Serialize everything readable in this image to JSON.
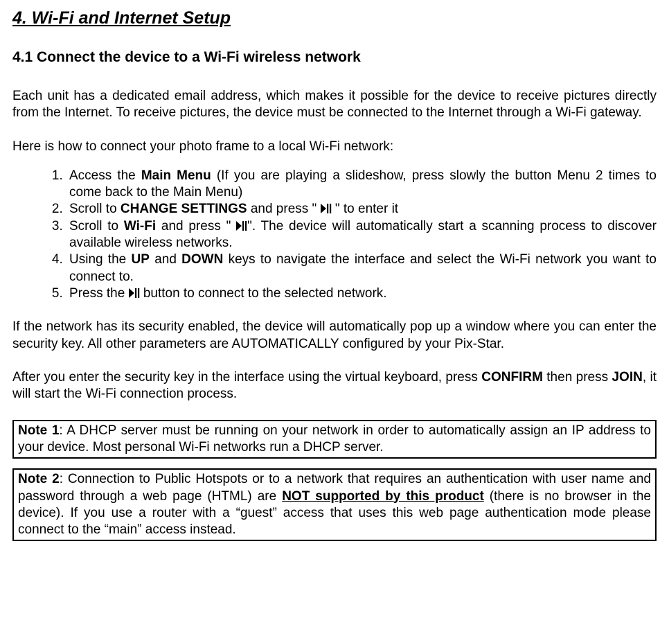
{
  "title": "4. Wi-Fi and Internet Setup",
  "subtitle": "4.1 Connect the device to a Wi-Fi wireless network",
  "intro1": "Each unit has a dedicated email address, which makes it possible for the device to receive pictures directly from the Internet. To receive pictures, the device must be connected to the Internet through a Wi-Fi gateway.",
  "intro2": "Here is how to connect your photo frame to a local Wi-Fi network:",
  "steps": {
    "s1a": "Access the ",
    "s1b": "Main Menu",
    "s1c": " (If you are playing a slideshow, press slowly the button Menu 2 times to come back to the Main Menu)",
    "s2a": "Scroll to ",
    "s2b": "CHANGE SETTINGS",
    "s2c": " and press \" ",
    "s2d": " \" to enter it",
    "s3a": "Scroll to ",
    "s3b": "Wi-Fi",
    "s3c": " and press \" ",
    "s3d": "\".  The device will automatically start a scanning process to discover available wireless networks.",
    "s4a": "Using the ",
    "s4b": "UP",
    "s4c": " and ",
    "s4d": "DOWN",
    "s4e": " keys to navigate the interface and select the Wi-Fi network you want to connect to.",
    "s5a": "Press the ",
    "s5b": " button to connect to the selected network."
  },
  "para_security": "If the network has its security enabled, the device will automatically pop up a window where you can enter the security key. All other parameters are AUTOMATICALLY configured by your Pix-Star.",
  "para_confirm_a": "After you enter the security key in the interface using the virtual keyboard, press ",
  "para_confirm_b": "CONFIRM",
  "para_confirm_c": " then press ",
  "para_confirm_d": "JOIN",
  "para_confirm_e": ", it will start the Wi-Fi connection process.",
  "note1_label": "Note 1",
  "note1_body": ": A DHCP server must be running on your network in order to automatically assign an IP address to your device. Most personal Wi-Fi networks run a DHCP server.",
  "note2_label": "Note 2",
  "note2_a": ": Connection to Public Hotspots or to a network that requires an authentication with user name and password through a web page (HTML) are ",
  "note2_b": "NOT supported by this product",
  "note2_c": " (there is no browser in the device). If you use a router with a “guest” access that uses this web page authentication mode please connect to the “main” access instead."
}
